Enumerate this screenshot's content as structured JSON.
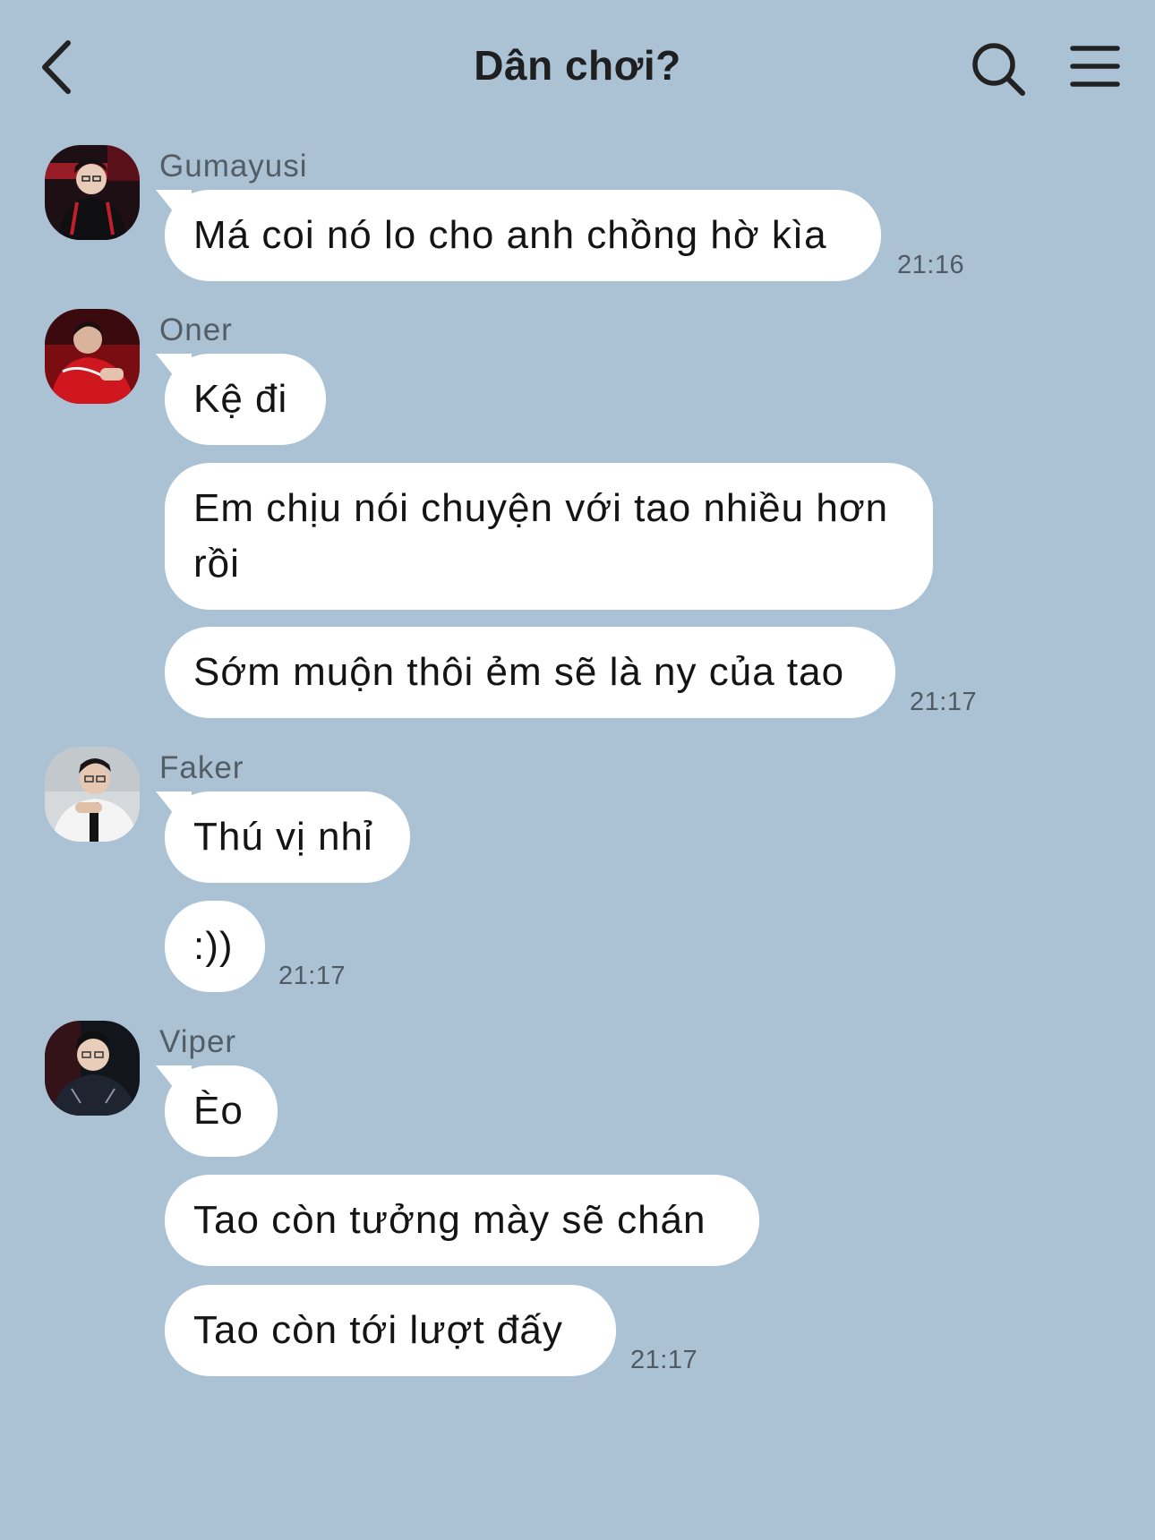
{
  "header": {
    "title": "Dân chơi?"
  },
  "icons": {
    "back": "chevron-left-icon",
    "search": "search-icon",
    "menu": "hamburger-menu-icon"
  },
  "colors": {
    "background": "#abc1d4",
    "bubble": "#ffffff",
    "text": "#141414",
    "meta": "#535d66"
  },
  "groups": [
    {
      "sender": "Gumayusi",
      "messages": [
        "Má coi nó lo cho anh chồng hờ kìa"
      ],
      "time": "21:16"
    },
    {
      "sender": "Oner",
      "messages": [
        "Kệ đi",
        "Em chịu nói chuyện với tao nhiều hơn rồi",
        "Sớm muộn thôi ẻm sẽ là ny của tao"
      ],
      "time": "21:17"
    },
    {
      "sender": "Faker",
      "messages": [
        "Thú vị nhỉ",
        ":))"
      ],
      "time": "21:17"
    },
    {
      "sender": "Viper",
      "messages": [
        "Èo",
        "Tao còn tưởng mày sẽ chán",
        "Tao còn tới lượt đấy"
      ],
      "time": "21:17"
    }
  ]
}
